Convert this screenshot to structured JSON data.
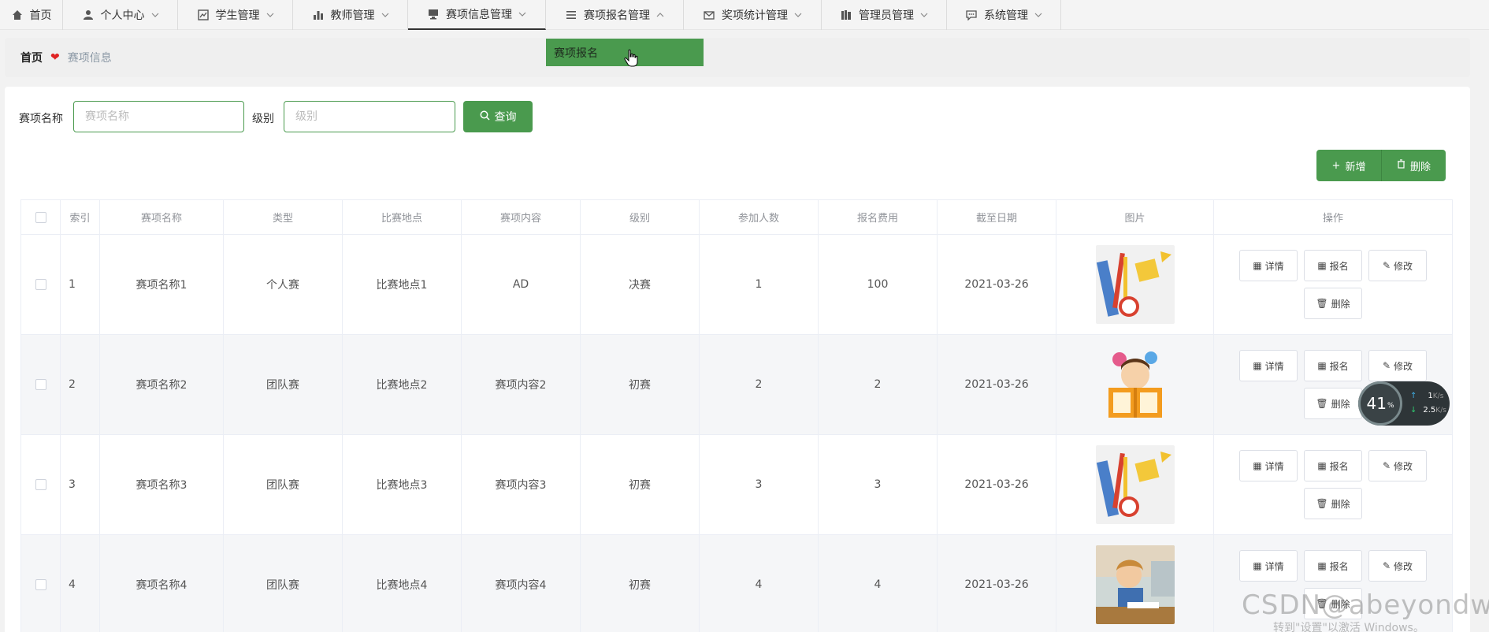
{
  "nav": {
    "items": [
      {
        "label": "首页",
        "icon": "home-icon"
      },
      {
        "label": "个人中心",
        "icon": "user-icon"
      },
      {
        "label": "学生管理",
        "icon": "chart-icon"
      },
      {
        "label": "教师管理",
        "icon": "bar-chart-icon"
      },
      {
        "label": "赛项信息管理",
        "icon": "monitor-icon"
      },
      {
        "label": "赛项报名管理",
        "icon": "list-icon"
      },
      {
        "label": "奖项统计管理",
        "icon": "mail-icon"
      },
      {
        "label": "管理员管理",
        "icon": "book-icon"
      },
      {
        "label": "系统管理",
        "icon": "chat-icon"
      }
    ],
    "dropdown_item": "赛项报名"
  },
  "breadcrumb": {
    "home": "首页",
    "current": "赛项信息"
  },
  "search": {
    "name_label": "赛项名称",
    "name_placeholder": "赛项名称",
    "level_label": "级别",
    "level_placeholder": "级别",
    "query_label": "查询"
  },
  "actions": {
    "add_label": "新增",
    "delete_label": "删除"
  },
  "table": {
    "headers": [
      "索引",
      "赛项名称",
      "类型",
      "比赛地点",
      "赛项内容",
      "级别",
      "参加人数",
      "报名费用",
      "截至日期",
      "图片",
      "操作"
    ],
    "rows": [
      {
        "index": "1",
        "name": "赛项名称1",
        "type": "个人赛",
        "location": "比赛地点1",
        "content": "AD",
        "level": "决赛",
        "participants": "1",
        "fee": "100",
        "deadline": "2021-03-26",
        "image": "stationery-image"
      },
      {
        "index": "2",
        "name": "赛项名称2",
        "type": "团队赛",
        "location": "比赛地点2",
        "content": "赛项内容2",
        "level": "初赛",
        "participants": "2",
        "fee": "2",
        "deadline": "2021-03-26",
        "image": "reading-child-image"
      },
      {
        "index": "3",
        "name": "赛项名称3",
        "type": "团队赛",
        "location": "比赛地点3",
        "content": "赛项内容3",
        "level": "初赛",
        "participants": "3",
        "fee": "3",
        "deadline": "2021-03-26",
        "image": "stationery-image"
      },
      {
        "index": "4",
        "name": "赛项名称4",
        "type": "团队赛",
        "location": "比赛地点4",
        "content": "赛项内容4",
        "level": "初赛",
        "participants": "4",
        "fee": "4",
        "deadline": "2021-03-26",
        "image": "student-photo-image"
      }
    ],
    "op_labels": {
      "detail": "详情",
      "signup": "报名",
      "edit": "修改",
      "delete": "删除"
    }
  },
  "speed_widget": {
    "percent": "41",
    "percent_unit": "%",
    "up": "1",
    "up_unit": "K/s",
    "down": "2.5",
    "down_unit": "K/s"
  },
  "watermark": "CSDN@abeyondwild",
  "windows_note": "转到\"设置\"以激活 Windows。",
  "colors": {
    "accent": "#4a9a4e",
    "heart": "#e02424"
  }
}
